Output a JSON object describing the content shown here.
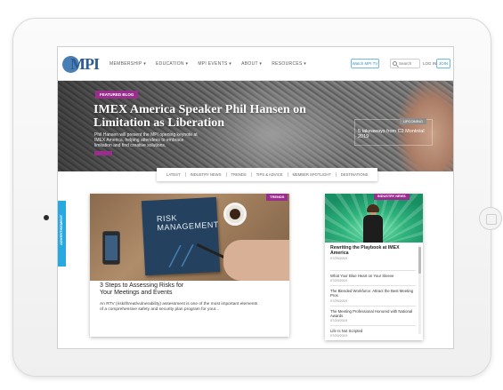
{
  "header": {
    "logo_text": "MPI",
    "nav": [
      "MEMBERSHIP ▾",
      "EDUCATION ▾",
      "MPI EVENTS ▾",
      "ABOUT ▾",
      "RESOURCES ▾"
    ],
    "mpitv_label": "Watch MPI TV",
    "search_placeholder": "Search",
    "login_label": "LOG IN",
    "join_label": "JOIN"
  },
  "hero": {
    "badge": "FEATURED BLOG",
    "title": "IMEX America Speaker Phil Hansen on Limitation as Liberation",
    "summary": "Phil Hansen will present the MPI opening keynote at IMEX America, helping attendees to embrace limitation and find creative solutions.",
    "side_badge": "UPCOMING",
    "side_title": "5 takeaways from C2 Montréal 2019"
  },
  "categories": [
    "LATEST",
    "INDUSTRY NEWS",
    "TRENDS",
    "TIPS & ADVICE",
    "MEMBER SPOTLIGHT",
    "DESTINATIONS"
  ],
  "ad_tab_label": "ADVERTISEMENT",
  "article": {
    "image_text": "RISK\nMANAGEMENT",
    "tag": "TRENDS",
    "title": "3 Steps to Assessing Risks for Your Meetings and Events",
    "summary": "An RTV (risk/threat/vulnerability) assessment is one of the most important elements of a comprehensive safety and security plan program for your..."
  },
  "news": {
    "badge": "INDUSTRY NEWS",
    "featured_title": "Rewriting the Playbook at IMEX America",
    "featured_date": "07/29/2019",
    "items": [
      {
        "title": "What Your Blue Heart on Your Sleeve",
        "date": "07/29/2019"
      },
      {
        "title": "The Blended Workforce: Attract the Best Meeting Pros",
        "date": "07/29/2019"
      },
      {
        "title": "The Meeting Professional Honored with National Awards",
        "date": "07/29/2019"
      },
      {
        "title": "Life Is Not Scripted",
        "date": "07/29/2019"
      }
    ]
  },
  "colors": {
    "brand_blue": "#2d5c92",
    "accent_purple": "#9b2d8f",
    "ad_blue": "#27a8e0"
  }
}
